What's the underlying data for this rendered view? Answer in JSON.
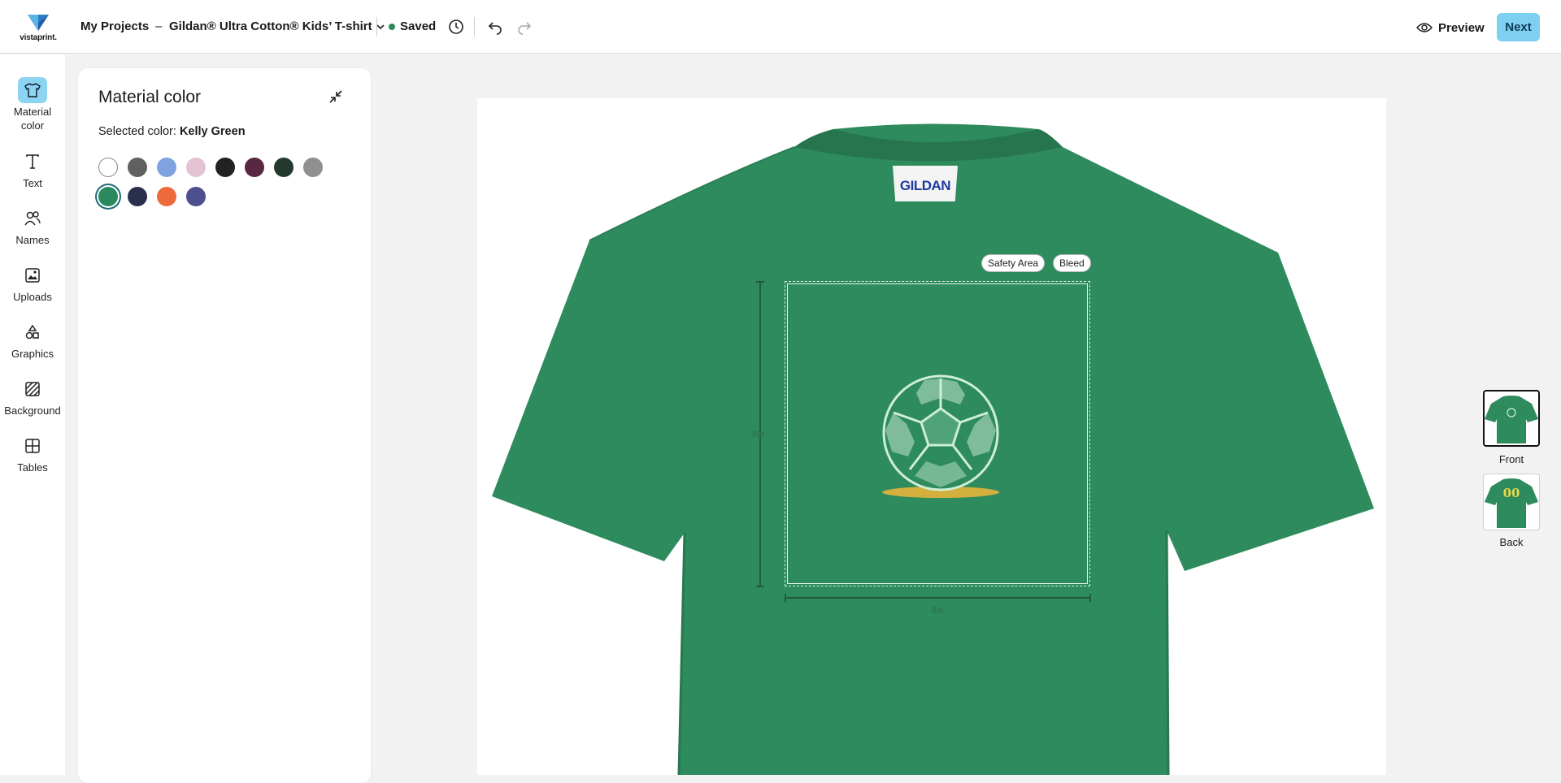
{
  "header": {
    "logo_text": "vistaprint.",
    "breadcrumb_projects": "My Projects",
    "breadcrumb_separator": "–",
    "product_name": "Gildan® Ultra Cotton® Kids’ T-shirt",
    "save_status": "Saved",
    "preview_label": "Preview",
    "next_label": "Next"
  },
  "sidebar": {
    "items": [
      {
        "label": "Material color",
        "icon": "tshirt-icon",
        "active": true
      },
      {
        "label": "Text",
        "icon": "text-icon"
      },
      {
        "label": "Names",
        "icon": "names-icon"
      },
      {
        "label": "Uploads",
        "icon": "image-upload-icon"
      },
      {
        "label": "Graphics",
        "icon": "shapes-icon"
      },
      {
        "label": "Background",
        "icon": "background-pattern-icon"
      },
      {
        "label": "Tables",
        "icon": "table-icon"
      }
    ]
  },
  "panel": {
    "title": "Material color",
    "selected_prefix": "Selected color:",
    "selected_color": "Kelly Green",
    "swatches": [
      "#ffffff",
      "#606060",
      "#7fa3e0",
      "#e3c3d3",
      "#222222",
      "#5a2743",
      "#24392e",
      "#8f8f8f",
      "#2a8a5e",
      "#2a2f4c",
      "#ee6a3d",
      "#4d4f8e"
    ],
    "selected_index": 8
  },
  "canvas": {
    "tag_text": "GILDAN",
    "safety_area_label": "Safety Area",
    "bleed_label": "Bleed",
    "height_dimension": "8in",
    "width_dimension": "8in",
    "shirt_color": "#2e8b5e"
  },
  "views": {
    "front_label": "Front",
    "back_label": "Back",
    "back_number": "00"
  }
}
